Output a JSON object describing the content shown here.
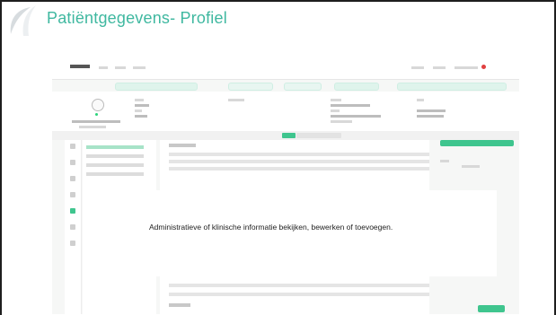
{
  "slide": {
    "title": "Patiëntgegevens- Profiel",
    "caption": "Administratieve of klinische informatie bekijken, bewerken of toevoegen.",
    "accent_color": "#3fb8a0"
  },
  "screenshot": {
    "status_colors": {
      "primary_green": "#3fc58e",
      "online_dot": "#2bd47a"
    }
  }
}
